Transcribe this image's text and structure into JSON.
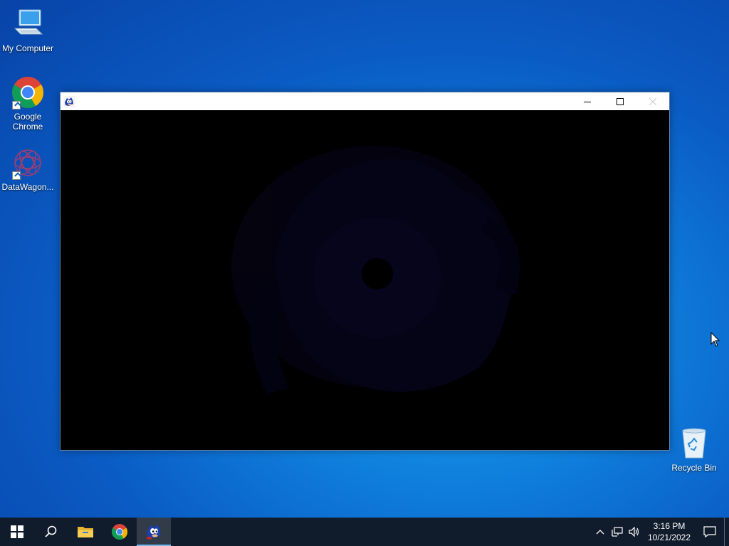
{
  "desktop": {
    "icons": [
      {
        "label": "My Computer",
        "icon": "computer-icon"
      },
      {
        "label": "Google Chrome",
        "icon": "chrome-icon"
      },
      {
        "label": "DataWagon...",
        "icon": "datawagon-icon"
      },
      {
        "label": "Recycle Bin",
        "icon": "recycle-bin-icon"
      }
    ]
  },
  "window": {
    "title": "",
    "icon": "sonic-app-icon",
    "buttons": [
      "minimize",
      "maximize",
      "close"
    ],
    "content": "sonic-logo-fading-black-screen"
  },
  "taskbar": {
    "items": [
      "start-icon",
      "search-icon",
      "file-explorer-icon",
      "chrome-icon",
      "sonic-app-icon"
    ],
    "active_item": "sonic-app-icon",
    "tray_icons": [
      "chevron-up-icon",
      "network-icon",
      "volume-icon"
    ],
    "time": "3:16 PM",
    "date": "10/21/2022"
  },
  "colors": {
    "desktop_accent": "#0f7fdc",
    "taskbar_bg": "#101c2b",
    "window_titlebar": "#ffffff",
    "window_client": "#000000"
  }
}
